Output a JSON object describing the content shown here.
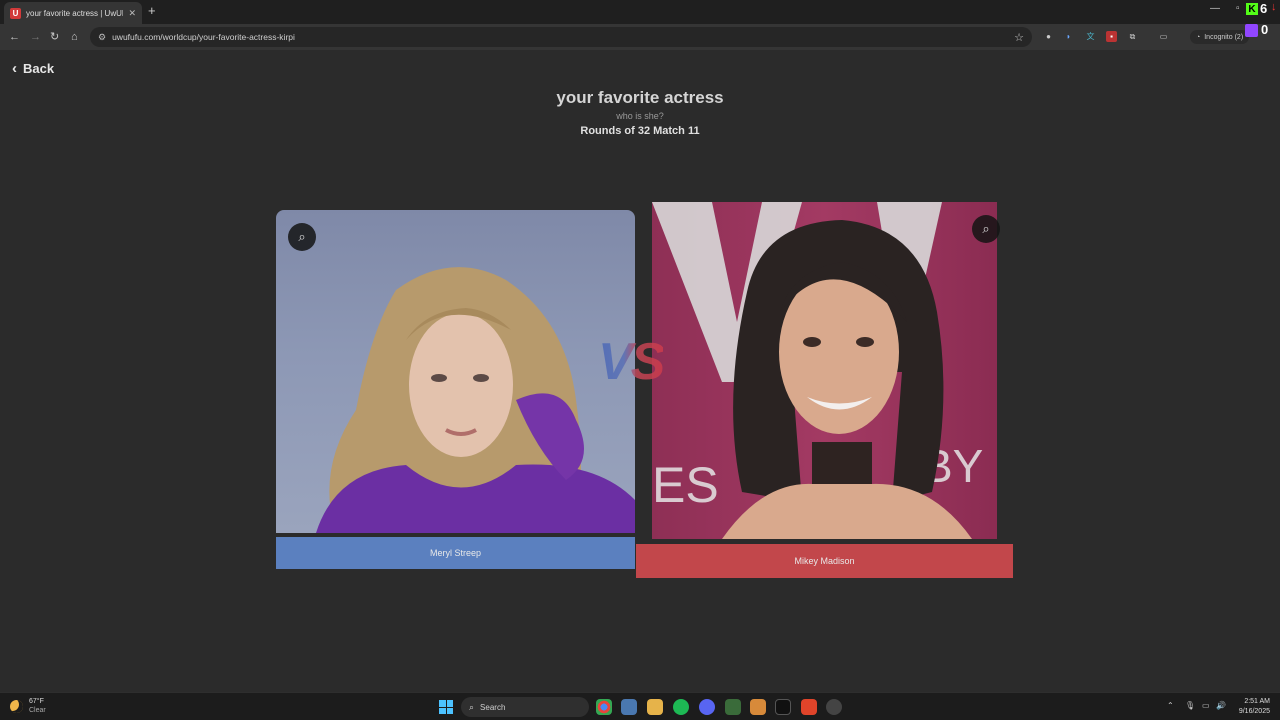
{
  "browser": {
    "tab_title": "your favorite actress | UwUFUFU",
    "tab_favicon_letter": "U",
    "new_tab": "+",
    "url": "uwufufu.com/worldcup/your-favorite-actress-kirpi",
    "incognito_label": "Incognito (2)",
    "kick_count": "6",
    "twitch_count": "0"
  },
  "page": {
    "back_label": "Back",
    "title": "your favorite actress",
    "subtitle": "who is she?",
    "rounds": "Rounds of 32 Match 11",
    "vs": "VS"
  },
  "contestants": [
    {
      "name": "Meryl Streep",
      "color": "#5b80bf"
    },
    {
      "name": "Mikey Madison",
      "color": "#c2474b"
    }
  ],
  "taskbar": {
    "weather_temp": "67°F",
    "weather_desc": "Clear",
    "search_label": "Search",
    "time": "2:51 AM",
    "date": "9/16/2025"
  }
}
